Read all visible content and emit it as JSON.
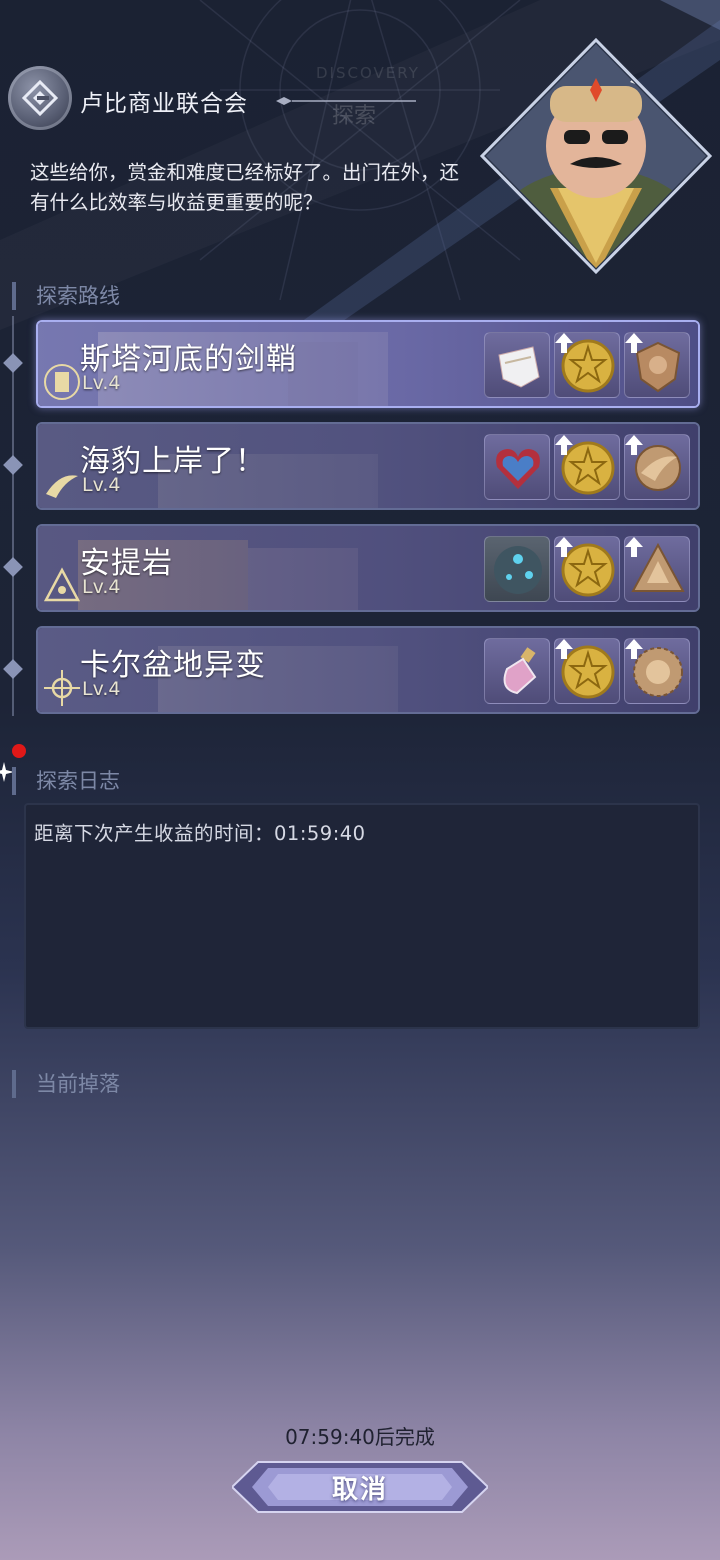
{
  "header": {
    "faction_name": "卢比商业联合会",
    "watermark_en": "DISCOVERY",
    "watermark_cn": "探索"
  },
  "dialog": {
    "text": "这些给你，赏金和难度已经标好了。出门在外，还有什么比效率与收益更重要的呢？"
  },
  "sections": {
    "routes_title": "探索路线",
    "log_title": "探索日志",
    "drops_title": "当前掉落"
  },
  "routes": [
    {
      "name": "斯塔河底的剑鞘",
      "level": "Lv.4",
      "active": true,
      "emblem": "city-crest-icon",
      "rewards": [
        "white-cloth-icon",
        "gold-coin-icon",
        "bronze-shield-icon"
      ]
    },
    {
      "name": "海豹上岸了！",
      "level": "Lv.4",
      "active": false,
      "emblem": "horn-crest-icon",
      "rewards": [
        "heart-box-icon",
        "gold-coin-icon",
        "bronze-wing-icon"
      ]
    },
    {
      "name": "安提岩",
      "level": "Lv.4",
      "active": false,
      "emblem": "triangle-crest-icon",
      "rewards": [
        "blue-orb-icon",
        "gold-coin-icon",
        "bronze-triangle-icon"
      ]
    },
    {
      "name": "卡尔盆地异变",
      "level": "Lv.4",
      "active": false,
      "emblem": "sun-crest-icon",
      "rewards": [
        "potion-bottle-icon",
        "gold-coin-icon",
        "bronze-medal-icon"
      ]
    }
  ],
  "log": {
    "text": "距离下次产生收益的时间：01:59:40"
  },
  "footer": {
    "complete_text": "07:59:40后完成",
    "cancel_label": "取消"
  },
  "colors": {
    "accent": "#a9aff0",
    "notification": "#e01818",
    "gold": "#d9b241"
  }
}
